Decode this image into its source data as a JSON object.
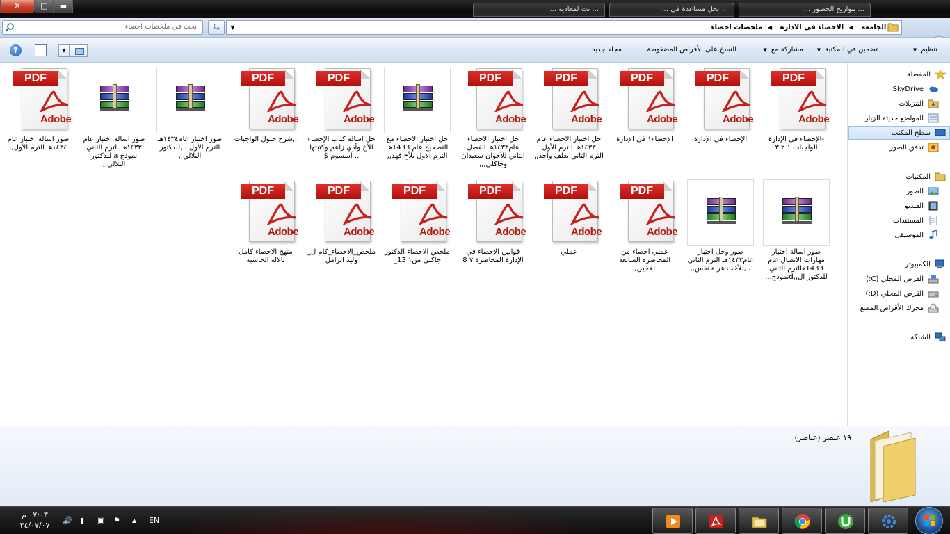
{
  "window": {
    "close_label": "✕",
    "max_label": "□",
    "min_label": "▬",
    "bg_tabs": [
      "... نت لمعادية ...",
      "... بحل مساعدة في ...",
      "... بتواريح الحضور ..."
    ]
  },
  "address": {
    "search_placeholder": "بحث في ملخصات احصاء",
    "breadcrumbs": [
      "الجامعه",
      "الاحصاء في الاداره",
      "ملخصات احصاء"
    ]
  },
  "toolbar": {
    "organize": "تنظيم",
    "include_library": "تضمين في المكتبة",
    "share_with": "مشاركة مع",
    "burn": "النسخ على الأقراص المضغوطة",
    "new_folder": "مجلد جديد",
    "help": "?"
  },
  "files": [
    {
      "name": "-الإحصاء في الإدارة الواجبات ١ ٢ ٣",
      "type": "pdf"
    },
    {
      "name": "الإحصاء في الإدارة",
      "type": "pdf"
    },
    {
      "name": "الإحصاء١ في الإدارة",
      "type": "pdf"
    },
    {
      "name": "حل أختبار الأحصاء عام ١٤٣٣هـ الترم الأول الترم الثاني بعلف واحد,,",
      "type": "pdf"
    },
    {
      "name": "حل أختبار الاحصاء عام١٤٣٣هـ الفصل الثاني للأخوان سعيدان وجاكلي,,,",
      "type": "pdf"
    },
    {
      "name": "حل أختبار الأحصاء مع التصحيح عام 1433هـ الترم الاول بلأخ فهد,,",
      "type": "rar"
    },
    {
      "name": "حل أسألة كتاب الإحصاء للأخ وأدي زاعم وكتبتها .. آسسوم $",
      "type": "pdf"
    },
    {
      "name": ",,شرح حلول الواجبات",
      "type": "pdf"
    },
    {
      "name": "صور أختبار عام١٤٣٤هـ الترم الأول ، ,للدكتور البلالي,,",
      "type": "rar"
    },
    {
      "name": "صور أسألة أختبار عام ١٤٣٣هـ الترم الثاني نموذج a للدكتور البلالي,,",
      "type": "rar"
    },
    {
      "name": "صور اسألة اختبار عام ١٤٣٤هـ الترم الأول,,",
      "type": "pdf"
    },
    {
      "name": "صور أسألة أختبار مهارات الاتصال عام 1433هالترم الثاني للدكتور ال,,dنموذج...",
      "type": "rar"
    },
    {
      "name": "صور وحل اختبار عام١٤٣٢هـ الترم الثاني ، ,للأخت غربة نفس,,",
      "type": "rar"
    },
    {
      "name": "عملي احصاء من المحاضره السابعه للاخير,,",
      "type": "pdf"
    },
    {
      "name": "عملي",
      "type": "pdf"
    },
    {
      "name": "قوانين الإحصاء في الإدارة المحاضرة ٧ 8",
      "type": "pdf"
    },
    {
      "name": "ملخص الاحصاء الدكتور جاكلي من١ 13_",
      "type": "pdf"
    },
    {
      "name": "ملخص_الاحصاء_كام ل_ وليد الزامل",
      "type": "pdf"
    },
    {
      "name": "منهج الاحصاء كامل بالالة الحاسبة",
      "type": "pdf"
    }
  ],
  "pdf_labels": {
    "banner": "PDF",
    "brand": "Adobe"
  },
  "sidebar": {
    "favorites": "المفضلة",
    "skydrive": "SkyDrive",
    "downloads": "التنزيلات",
    "recent": "المواضع حديثة الزيار",
    "desktop": "سطح المكتب",
    "photo_stream": "تدفق الصور",
    "libraries": "المكتبات",
    "pictures": "الصور",
    "videos": "الفيديو",
    "documents": "المستندات",
    "music": "الموسيقى",
    "computer": "الكمبيوتر",
    "disk_c": "القرص المحلي (C:)",
    "disk_d": "القرص المحلي (D:)",
    "cd_drive": "محرك الأقراص المضغ",
    "network": "الشبكة"
  },
  "details": {
    "count": "١٩ عنصر (عناصر)"
  },
  "taskbar": {
    "time": "٠٧:٠٣ م",
    "date": "٣٤/٠٧/٠٧",
    "lang": "EN",
    "tray_arrow": "▲"
  },
  "colors": {
    "pdf_red": "#c8201a",
    "selection_blue": "#cfe3f9",
    "chrome_blue": "#dce7f5"
  }
}
